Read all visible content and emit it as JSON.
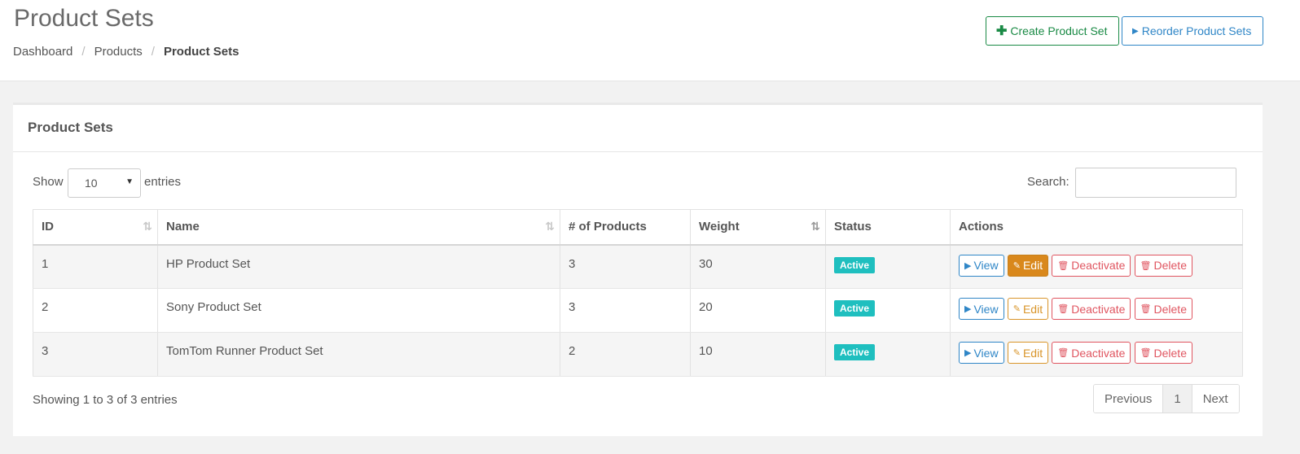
{
  "header": {
    "title": "Product Sets",
    "breadcrumb": [
      "Dashboard",
      "Products",
      "Product Sets"
    ],
    "create_label": "Create Product Set",
    "reorder_label": "Reorder Product Sets"
  },
  "panel": {
    "title": "Product Sets",
    "show_label": "Show",
    "page_length": "10",
    "entries_label": "entries",
    "search_label": "Search:",
    "search_value": ""
  },
  "table": {
    "columns": [
      "ID",
      "Name",
      "# of Products",
      "Weight",
      "Status",
      "Actions"
    ],
    "rows": [
      {
        "id": "1",
        "name": "HP Product Set",
        "products": "3",
        "weight": "30",
        "status": "Active"
      },
      {
        "id": "2",
        "name": "Sony Product Set",
        "products": "3",
        "weight": "20",
        "status": "Active"
      },
      {
        "id": "3",
        "name": "TomTom Runner Product Set",
        "products": "2",
        "weight": "10",
        "status": "Active"
      }
    ],
    "actions": {
      "view": "View",
      "edit": "Edit",
      "deactivate": "Deactivate",
      "delete": "Delete"
    }
  },
  "footer": {
    "info": "Showing 1 to 3 of 3 entries",
    "pager": {
      "previous": "Previous",
      "current": "1",
      "next": "Next"
    }
  },
  "colors": {
    "accent_green": "#1a8a45",
    "accent_blue": "#2f86c7",
    "status_active": "#1fbfbf",
    "edit_orange": "#d9881c",
    "danger_red": "#e05560"
  },
  "icons": {
    "create": "plus-icon",
    "reorder": "caret-right-icon",
    "view": "caret-right-icon",
    "edit": "edit-icon",
    "deactivate": "trash-icon",
    "delete": "trash-icon",
    "sort": "sort-icon"
  }
}
